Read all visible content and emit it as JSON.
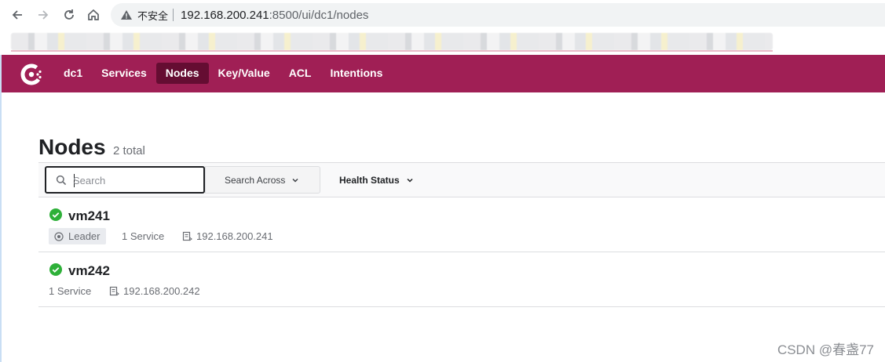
{
  "browser": {
    "insecure_label": "不安全",
    "url_host": "192.168.200.241",
    "url_rest": ":8500/ui/dc1/nodes"
  },
  "app": {
    "brand_color": "#a01f55",
    "active_nav_color": "#650d32",
    "nav": [
      {
        "label": "dc1",
        "active": false
      },
      {
        "label": "Services",
        "active": false
      },
      {
        "label": "Nodes",
        "active": true
      },
      {
        "label": "Key/Value",
        "active": false
      },
      {
        "label": "ACL",
        "active": false
      },
      {
        "label": "Intentions",
        "active": false
      }
    ]
  },
  "page": {
    "title": "Nodes",
    "count": "2 total"
  },
  "filters": {
    "search_placeholder": "Search",
    "search_across_label": "Search Across",
    "health_status_label": "Health Status"
  },
  "nodes": [
    {
      "name": "vm241",
      "status": "passing",
      "leader_label": "Leader",
      "services": "1 Service",
      "address": "192.168.200.241"
    },
    {
      "name": "vm242",
      "status": "passing",
      "services": "1 Service",
      "address": "192.168.200.242"
    }
  ],
  "watermark": "CSDN @春盏77",
  "status_color": "#2eb039"
}
